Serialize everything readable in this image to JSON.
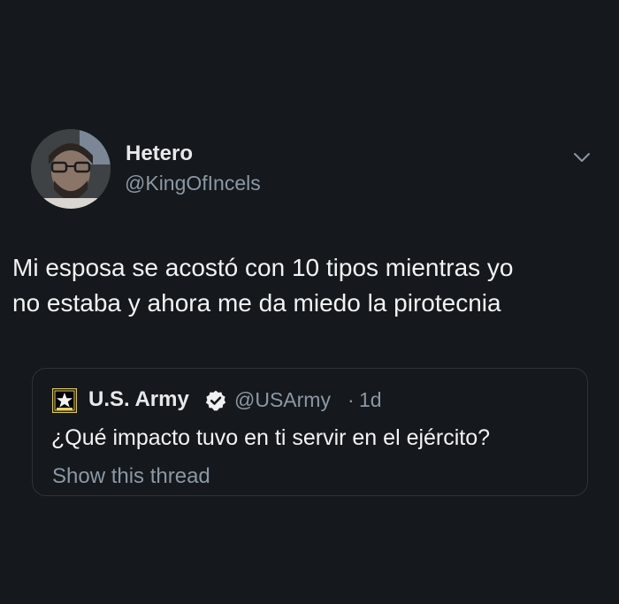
{
  "tweet": {
    "author": {
      "name": "Hetero",
      "handle": "@KingOfIncels"
    },
    "text": "Mi esposa se acostó con 10 tipos mientras yo\nno estaba y ahora me da miedo la pirotecnia",
    "icons": {
      "menu": "chevron-down-icon"
    }
  },
  "quoted_tweet": {
    "author": {
      "name": "U.S. Army",
      "handle": "@USArmy",
      "verified": true
    },
    "separator": "·",
    "time": "1d",
    "text": "¿Qué impacto tuvo en ti servir en el ejército?",
    "thread_link": "Show this thread",
    "icons": {
      "logo": "army-star-logo-icon",
      "verified": "verified-badge-icon"
    }
  },
  "colors": {
    "background": "#15181c",
    "primary_text": "#e7e9ea",
    "secondary_text": "#8b98a5",
    "border": "#2f3336"
  }
}
